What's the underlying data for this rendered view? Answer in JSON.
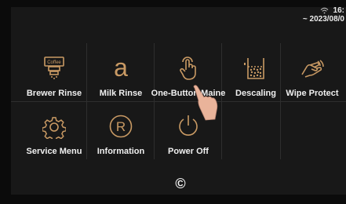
{
  "status": {
    "time": "16:",
    "date": "~ 2023/08/0"
  },
  "menu": {
    "row1": [
      {
        "label": "Brewer Rinse",
        "icon": "coffee-brewer-icon",
        "icon_text": "Coffee"
      },
      {
        "label": "Milk Rinse",
        "icon": "milk-rinse-icon",
        "icon_text": "a"
      },
      {
        "label": "One-Button Maine",
        "icon": "touch-hand-icon"
      },
      {
        "label": "Descaling",
        "icon": "descaling-icon"
      },
      {
        "label": "Wipe Protect",
        "icon": "wipe-hand-icon"
      }
    ],
    "row2": [
      {
        "label": "Service Menu",
        "icon": "gear-icon"
      },
      {
        "label": "Information",
        "icon": "registered-icon",
        "icon_text": "R"
      },
      {
        "label": "Power Off",
        "icon": "power-icon"
      }
    ]
  },
  "footer": {
    "symbol": "©"
  },
  "colors": {
    "accent": "#c99a64",
    "background": "#181818",
    "text": "#f0f0f0"
  }
}
